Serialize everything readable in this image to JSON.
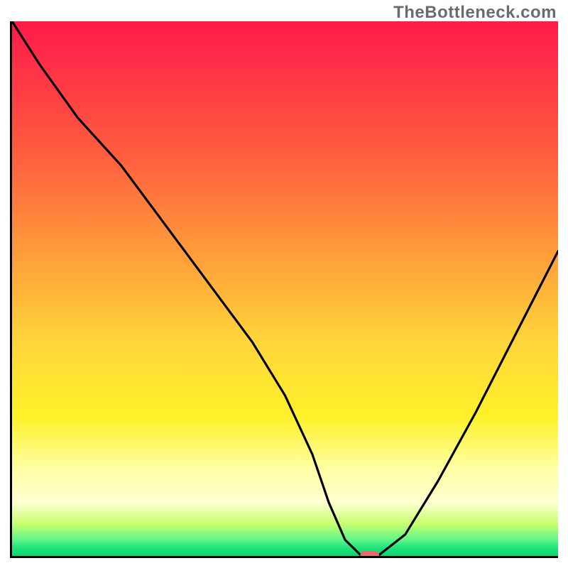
{
  "watermark": "TheBottleneck.com",
  "chart_data": {
    "type": "line",
    "title": "",
    "xlabel": "",
    "ylabel": "",
    "xlim": [
      0,
      100
    ],
    "ylim": [
      0,
      100
    ],
    "grid": false,
    "series": [
      {
        "name": "bottleneck-curve",
        "x": [
          0,
          5,
          12,
          20,
          28,
          36,
          44,
          50,
          55,
          58,
          61,
          64,
          67,
          72,
          78,
          85,
          92,
          100
        ],
        "y": [
          100,
          92,
          82,
          73,
          62,
          51,
          40,
          30,
          19,
          10,
          3,
          0,
          0,
          4,
          14,
          27,
          41,
          57
        ]
      }
    ],
    "annotations": [
      {
        "name": "optimum-pill",
        "x": 65.5,
        "y": 0
      }
    ],
    "background_gradient": {
      "direction": "vertical",
      "stops": [
        {
          "value": 100,
          "color": "#ff1a4b"
        },
        {
          "value": 76,
          "color": "#ff5a3f"
        },
        {
          "value": 55,
          "color": "#ffa23a"
        },
        {
          "value": 40,
          "color": "#ffd53a"
        },
        {
          "value": 26,
          "color": "#fff12a"
        },
        {
          "value": 16,
          "color": "#ffffa8"
        },
        {
          "value": 10,
          "color": "#ffffd0"
        },
        {
          "value": 6,
          "color": "#c7ff6e"
        },
        {
          "value": 3,
          "color": "#5ff58a"
        },
        {
          "value": 1.5,
          "color": "#1ee27a"
        },
        {
          "value": 0,
          "color": "#0ed66f"
        }
      ]
    }
  }
}
